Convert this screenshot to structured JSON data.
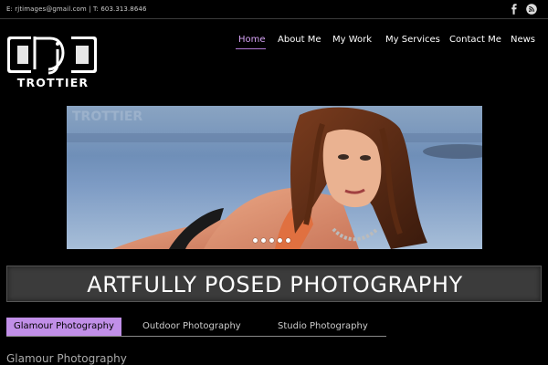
{
  "topbar": {
    "contact": "E: rjtimages@gmail.com | T: 603.313.8646"
  },
  "social": {
    "facebook_icon": "facebook-icon",
    "rss_icon": "rss-icon"
  },
  "logo": {
    "monogram": "RJ",
    "wordmark": "TROTTIER"
  },
  "nav": {
    "items": [
      {
        "label": "Home",
        "active": true
      },
      {
        "label": "About Me"
      },
      {
        "label": "My Work"
      },
      {
        "label": "My Services"
      },
      {
        "label": "Contact Me"
      },
      {
        "label": "News"
      }
    ]
  },
  "hero": {
    "watermark": "TROTTIER",
    "slides": 5
  },
  "banner": {
    "title": "ARTFULLY POSED PHOTOGRAPHY"
  },
  "tabs": [
    {
      "label": "Glamour Photography",
      "active": true
    },
    {
      "label": "Outdoor Photography"
    },
    {
      "label": "Studio Photography"
    }
  ],
  "section": {
    "title": "Glamour Photography"
  },
  "colors": {
    "accent": "#c18fe8",
    "nav_active": "#d6a3f5",
    "banner_bg": "#3b3b3b"
  }
}
